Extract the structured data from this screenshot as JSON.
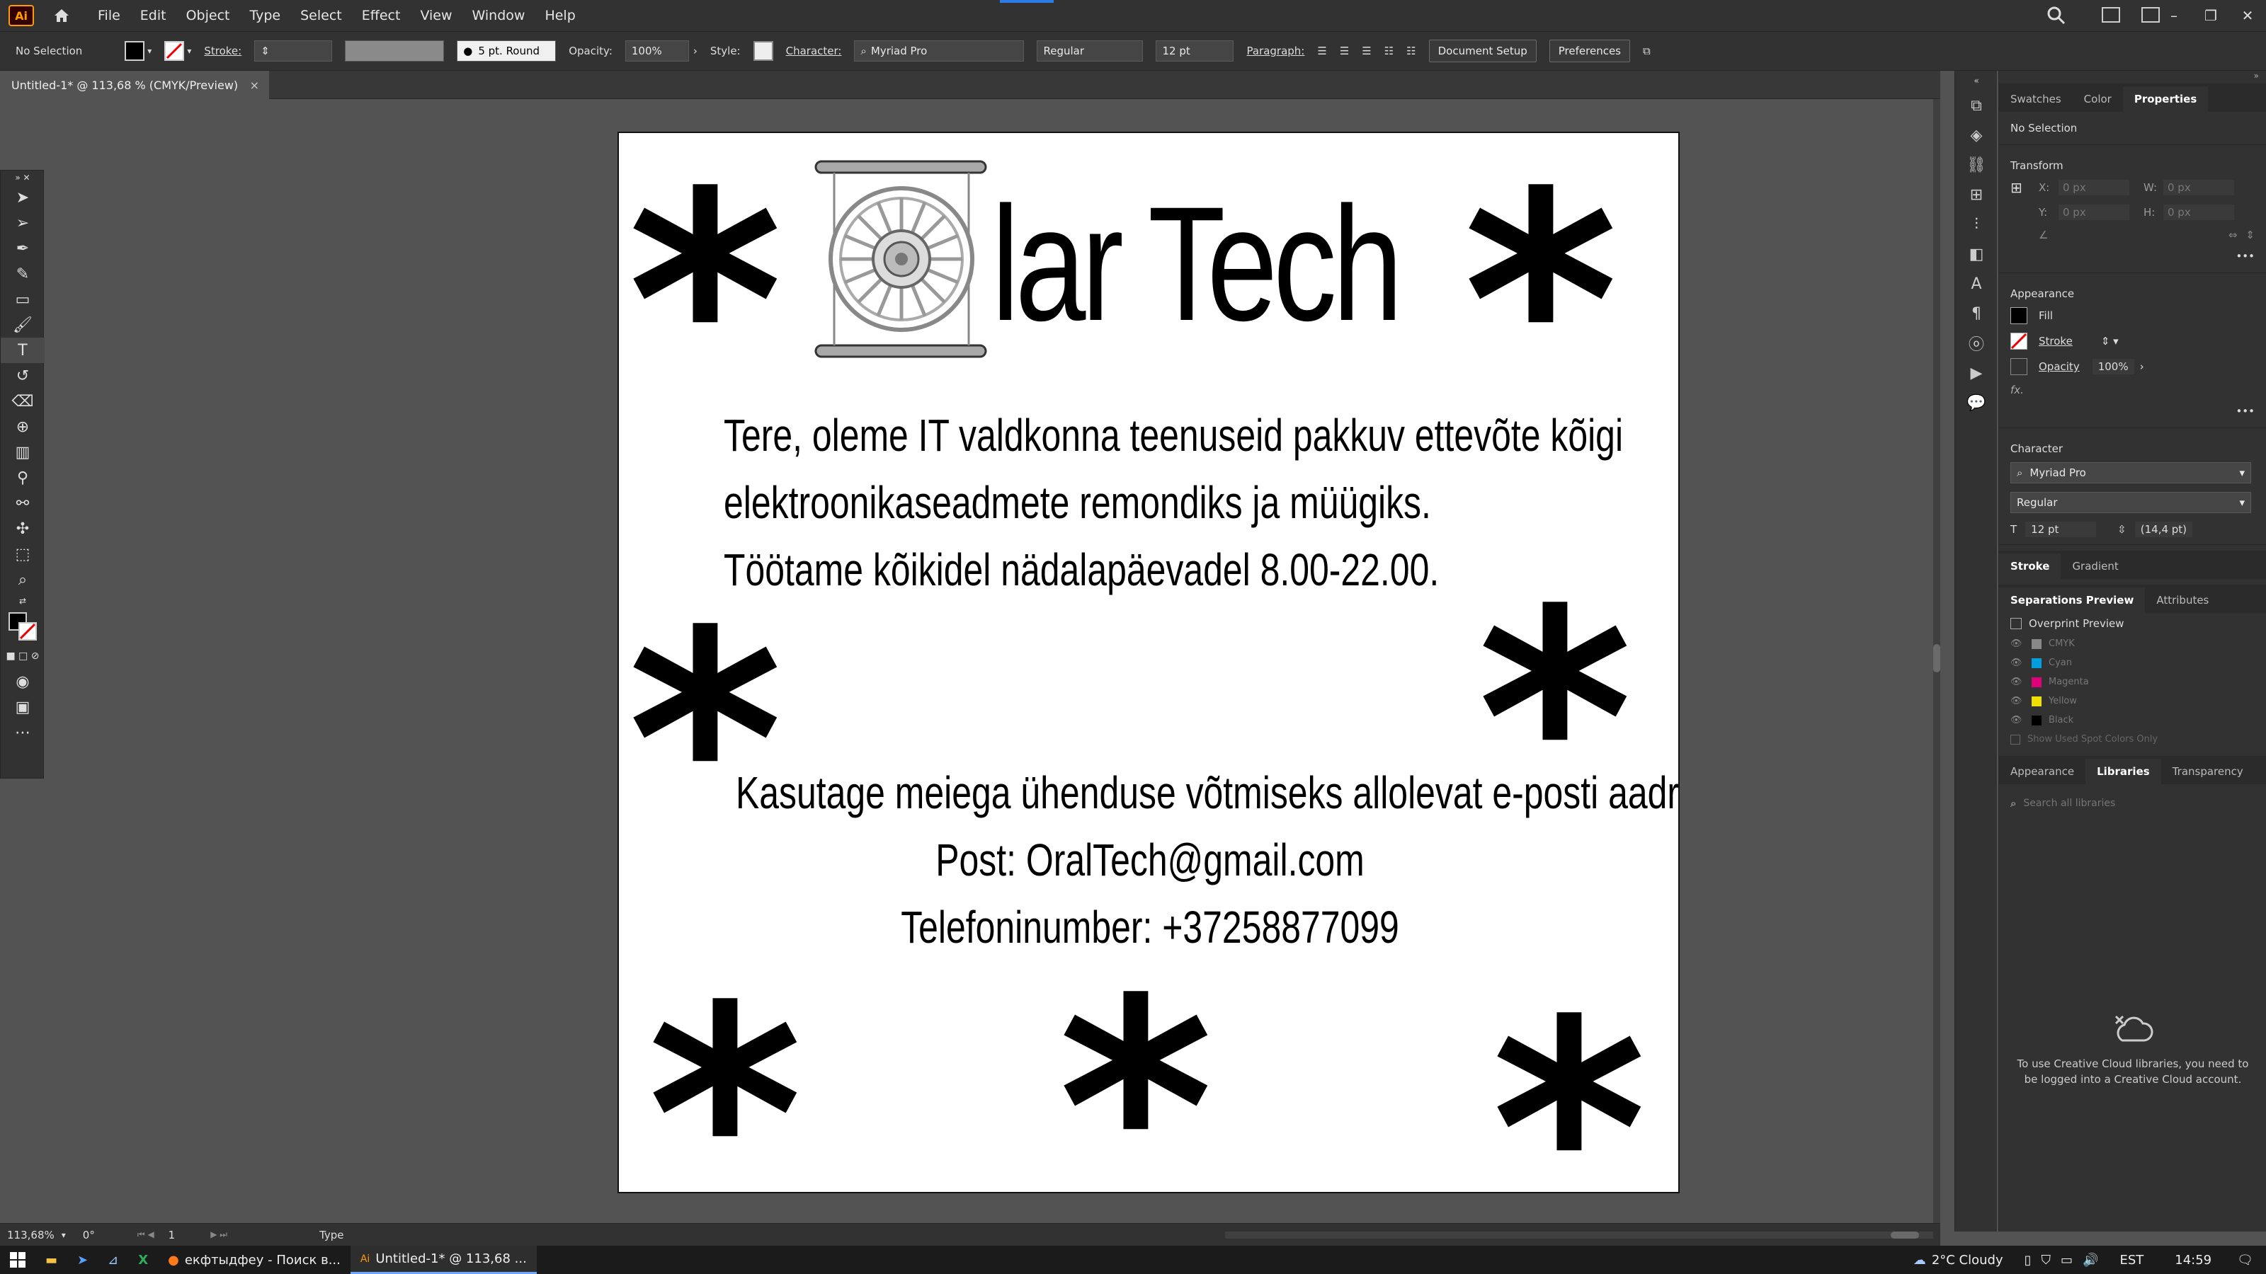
{
  "app": {
    "logo": "Ai"
  },
  "menu": [
    "File",
    "Edit",
    "Object",
    "Type",
    "Select",
    "Effect",
    "View",
    "Window",
    "Help"
  ],
  "window_controls": [
    "–",
    "❐",
    "✕"
  ],
  "control_bar": {
    "selection": "No Selection",
    "stroke_label": "Stroke:",
    "brush": "5 pt. Round",
    "opacity_label": "Opacity:",
    "opacity": "100%",
    "style_label": "Style:",
    "character_label": "Character:",
    "font": "Myriad Pro",
    "font_style": "Regular",
    "font_size": "12 pt",
    "paragraph_label": "Paragraph:",
    "document_setup": "Document Setup",
    "preferences": "Preferences"
  },
  "document_tab": {
    "title": "Untitled-1* @ 113,68 % (CMYK/Preview)",
    "close": "×"
  },
  "artboard": {
    "headline": "lar Tech",
    "asterisk": "*",
    "paragraph": [
      "Tere, oleme IT valdkonna teenuseid pakkuv ettevõte kõigi",
      "elektroonikaseadmete remondiks ja müügiks.",
      "Töötame kõikidel nädalapäevadel 8.00-22.00."
    ],
    "contact": [
      "Kasutage meiega ühenduse võtmiseks allolevat e-posti aadressi ja telefoninumbrit.",
      "Post: OralTech@gmail.com",
      "Telefoninumber: +37258877099"
    ]
  },
  "properties_panel": {
    "tabs": [
      "Swatches",
      "Color",
      "Properties"
    ],
    "no_selection": "No Selection",
    "transform": "Transform",
    "x_label": "X:",
    "y_label": "Y:",
    "w_label": "W:",
    "h_label": "H:",
    "x": "0 px",
    "y": "0 px",
    "w": "0 px",
    "h": "0 px",
    "appearance": "Appearance",
    "fill": "Fill",
    "stroke": "Stroke",
    "opacity_label": "Opacity",
    "opacity": "100%",
    "fx": "fx.",
    "character": "Character",
    "font": "Myriad Pro",
    "font_style": "Regular",
    "size": "12 pt",
    "leading": "(14,4 pt)"
  },
  "stroke_gradient_tabs": [
    "Stroke",
    "Gradient"
  ],
  "separations": {
    "tabs": [
      "Separations Preview",
      "Attributes"
    ],
    "overprint": "Overprint Preview",
    "plates": [
      {
        "name": "CMYK",
        "color": "#888888"
      },
      {
        "name": "Cyan",
        "color": "#00a0e0"
      },
      {
        "name": "Magenta",
        "color": "#e0007a"
      },
      {
        "name": "Yellow",
        "color": "#f0e000"
      },
      {
        "name": "Black",
        "color": "#000000"
      }
    ],
    "spot_only": "Show Used Spot Colors Only"
  },
  "libraries": {
    "tabs": [
      "Appearance",
      "Libraries",
      "Transparency"
    ],
    "search_placeholder": "Search all libraries",
    "message": "To use Creative Cloud libraries, you need to be logged into a Creative Cloud account."
  },
  "status_bar": {
    "zoom": "113,68%",
    "rotation": "0°",
    "artboard": "1",
    "tool": "Type"
  },
  "taskbar": {
    "browser_task": "екфтыдфеу - Поиск в...",
    "ai_task": "Untitled-1* @ 113,68 ...",
    "weather": "2°C  Cloudy",
    "lang": "EST",
    "time": "14:59"
  }
}
